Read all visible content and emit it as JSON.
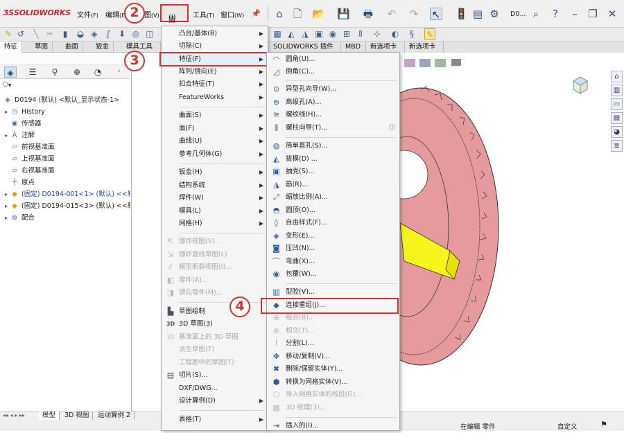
{
  "app": {
    "logo": "SOLIDWORKS"
  },
  "menubar": [
    {
      "id": "file",
      "label": "文件",
      "key": "(F)"
    },
    {
      "id": "edit",
      "label": "编辑",
      "key": "(E)"
    },
    {
      "id": "view",
      "label": "视图",
      "key": "(V)"
    },
    {
      "id": "insert",
      "label": "插入",
      "key": "(I)"
    },
    {
      "id": "tools",
      "label": "工具",
      "key": "(T)"
    },
    {
      "id": "window",
      "label": "窗口",
      "key": "(W)"
    }
  ],
  "doc_name": "D0...",
  "tabs": [
    "特征",
    "草图",
    "曲面",
    "钣金",
    "模具工具",
    "SOLIDWORKS 插件",
    "MBD",
    "新选项卡",
    "新选项卡"
  ],
  "tree": {
    "root": "D0194 (默认) <默认_显示状态-1>",
    "items": [
      {
        "label": "History",
        "arrow": "▸",
        "icon": "history-icon"
      },
      {
        "label": "传感器",
        "arrow": "",
        "icon": "sensor-icon"
      },
      {
        "label": "注解",
        "arrow": "▸",
        "icon": "annotation-icon"
      },
      {
        "label": "前视基准面",
        "arrow": "",
        "icon": "plane-icon"
      },
      {
        "label": "上视基准面",
        "arrow": "",
        "icon": "plane-icon"
      },
      {
        "label": "右视基准面",
        "arrow": "",
        "icon": "plane-icon"
      },
      {
        "label": "原点",
        "arrow": "",
        "icon": "origin-icon"
      },
      {
        "label": "(固定) D0194-001<1> (默认) <<默",
        "arrow": "▸",
        "icon": "part-icon",
        "blue": true
      },
      {
        "label": "(固定) D0194-015<3> (默认) <<默",
        "arrow": "▸",
        "icon": "part-icon",
        "blue": false
      },
      {
        "label": "配合",
        "arrow": "▸",
        "icon": "mate-icon"
      }
    ]
  },
  "insert_menu": {
    "groups": [
      [
        {
          "label": "凸台/基体(B)",
          "sub": true
        },
        {
          "label": "切除(C)",
          "sub": true
        },
        {
          "label": "特征(F)",
          "sub": true
        },
        {
          "label": "阵列/镜向(E)",
          "sub": true
        },
        {
          "label": "扣合特征(T)",
          "sub": true
        },
        {
          "label": "FeatureWorks",
          "sub": true
        }
      ],
      [
        {
          "label": "曲面(S)",
          "sub": true
        },
        {
          "label": "面(F)",
          "sub": true
        },
        {
          "label": "曲线(U)",
          "sub": true
        },
        {
          "label": "参考几何体(G)",
          "sub": true
        }
      ],
      [
        {
          "label": "钣金(H)",
          "sub": true
        },
        {
          "label": "结构系统",
          "sub": true
        },
        {
          "label": "焊件(W)",
          "sub": true
        },
        {
          "label": "模具(L)",
          "sub": true
        },
        {
          "label": "网格(H)",
          "sub": true
        }
      ],
      [
        {
          "label": "爆炸视图(V)...",
          "disabled": true,
          "icon": "exploded-view-icon"
        },
        {
          "label": "爆炸直线草图(L)",
          "disabled": true,
          "icon": "explode-line-icon"
        },
        {
          "label": "模型断裂视图(I)...",
          "disabled": true,
          "icon": "break-view-icon"
        },
        {
          "label": "零件(A)...",
          "disabled": true,
          "icon": "part-insert-icon"
        },
        {
          "label": "镜向零件(M)...",
          "disabled": true,
          "icon": "mirror-part-icon"
        }
      ],
      [
        {
          "label": "草图绘制",
          "icon": "sketch-icon"
        },
        {
          "label": "3D 草图(3)",
          "icon": "3d-sketch-icon"
        },
        {
          "label": "基准面上的 3D 草图",
          "disabled": true,
          "icon": "3d-sketch-plane-icon"
        },
        {
          "label": "派生草图(T)",
          "disabled": true
        },
        {
          "label": "工程图中的草图(T)",
          "disabled": true
        },
        {
          "label": "切片(S)...",
          "icon": "slice-icon"
        },
        {
          "label": "DXF/DWG..."
        },
        {
          "label": "设计算例(D)",
          "sub": true
        }
      ],
      [
        {
          "label": "表格(T)",
          "sub": true
        }
      ]
    ]
  },
  "feature_menu": {
    "groups": [
      [
        {
          "label": "圆角(U)...",
          "icon": "fillet-icon"
        },
        {
          "label": "倒角(C)...",
          "icon": "chamfer-icon"
        }
      ],
      [
        {
          "label": "异型孔向导(W)...",
          "icon": "hole-wizard-icon"
        },
        {
          "label": "高级孔(A)...",
          "icon": "advanced-hole-icon"
        },
        {
          "label": "螺纹线(H)...",
          "icon": "thread-icon"
        },
        {
          "label": "螺柱向导(T)...",
          "icon": "stud-wizard-icon",
          "help": true
        }
      ],
      [
        {
          "label": "简单直孔(S)...",
          "icon": "simple-hole-icon"
        },
        {
          "label": "拔模(D) ...",
          "icon": "draft-icon"
        },
        {
          "label": "抽壳(S)...",
          "icon": "shell-icon"
        },
        {
          "label": "筋(R)...",
          "icon": "rib-icon"
        },
        {
          "label": "缩放比例(A)...",
          "icon": "scale-icon"
        },
        {
          "label": "圆顶(O)...",
          "icon": "dome-icon"
        },
        {
          "label": "自由样式(F)...",
          "icon": "freeform-icon"
        },
        {
          "label": "变形(E)...",
          "icon": "deform-icon"
        },
        {
          "label": "压凹(N)...",
          "icon": "indent-icon"
        },
        {
          "label": "弯曲(X)...",
          "icon": "flex-icon"
        },
        {
          "label": "包覆(W)...",
          "icon": "wrap-icon"
        }
      ],
      [
        {
          "label": "型腔(V)...",
          "icon": "cavity-icon"
        },
        {
          "label": "连接重组(J)...",
          "icon": "join-icon"
        },
        {
          "label": "组合(B)...",
          "disabled": true,
          "icon": "combine-icon"
        },
        {
          "label": "相交(T)...",
          "disabled": true,
          "icon": "intersect-icon"
        },
        {
          "label": "分割(L)...",
          "icon": "split-icon"
        },
        {
          "label": "移动/复制(V)...",
          "icon": "move-copy-icon"
        },
        {
          "label": "删除/保留实体(Y)...",
          "icon": "delete-body-icon"
        },
        {
          "label": "转换为网格实体(V)...",
          "icon": "convert-mesh-icon"
        },
        {
          "label": "导入网格实体的线段(G)...",
          "disabled": true,
          "icon": "mesh-segment-icon"
        },
        {
          "label": "3D 纹理(3)...",
          "disabled": true,
          "icon": "3d-texture-icon"
        }
      ],
      [
        {
          "label": "插入的(I)...",
          "icon": "inserted-icon"
        }
      ]
    ]
  },
  "bottom_tabs": [
    "模型",
    "3D 视图",
    "运动算例 2"
  ],
  "status": {
    "editing": "在编辑 零件",
    "units": "自定义"
  },
  "badges": {
    "step2": "2",
    "step3": "3",
    "step4": "4"
  }
}
